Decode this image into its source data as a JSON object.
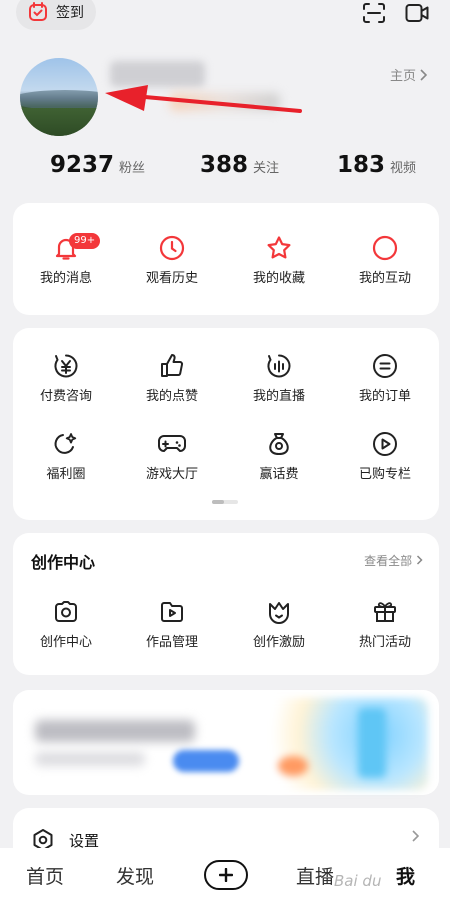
{
  "colors": {
    "accent": "#f3373a",
    "background": "#f1f1f3",
    "card": "#ffffff"
  },
  "topbar": {
    "checkin_label": "签到"
  },
  "profile": {
    "homepage_label": "主页"
  },
  "stats": [
    {
      "value": "9237",
      "label": "粉丝"
    },
    {
      "value": "388",
      "label": "关注"
    },
    {
      "value": "183",
      "label": "视频"
    }
  ],
  "quick": {
    "badge": "99+",
    "items": [
      {
        "label": "我的消息",
        "icon": "bell-icon"
      },
      {
        "label": "观看历史",
        "icon": "clock-icon"
      },
      {
        "label": "我的收藏",
        "icon": "star-icon"
      },
      {
        "label": "我的互动",
        "icon": "circle-icon"
      }
    ]
  },
  "services": {
    "items": [
      {
        "label": "付费咨询",
        "icon": "yen-icon"
      },
      {
        "label": "我的点赞",
        "icon": "thumbs-up-icon"
      },
      {
        "label": "我的直播",
        "icon": "live-icon"
      },
      {
        "label": "我的订单",
        "icon": "order-icon"
      },
      {
        "label": "福利圈",
        "icon": "welfare-icon"
      },
      {
        "label": "游戏大厅",
        "icon": "gamepad-icon"
      },
      {
        "label": "赢话费",
        "icon": "money-bag-icon"
      },
      {
        "label": "已购专栏",
        "icon": "play-icon"
      }
    ]
  },
  "creator": {
    "title": "创作中心",
    "view_all": "查看全部",
    "items": [
      {
        "label": "创作中心",
        "icon": "camera-icon"
      },
      {
        "label": "作品管理",
        "icon": "folder-play-icon"
      },
      {
        "label": "创作激励",
        "icon": "crown-icon"
      },
      {
        "label": "热门活动",
        "icon": "gift-icon"
      }
    ]
  },
  "settings": {
    "label": "设置"
  },
  "nav": {
    "home": "首页",
    "discover": "发现",
    "live": "直播",
    "me": "我"
  }
}
